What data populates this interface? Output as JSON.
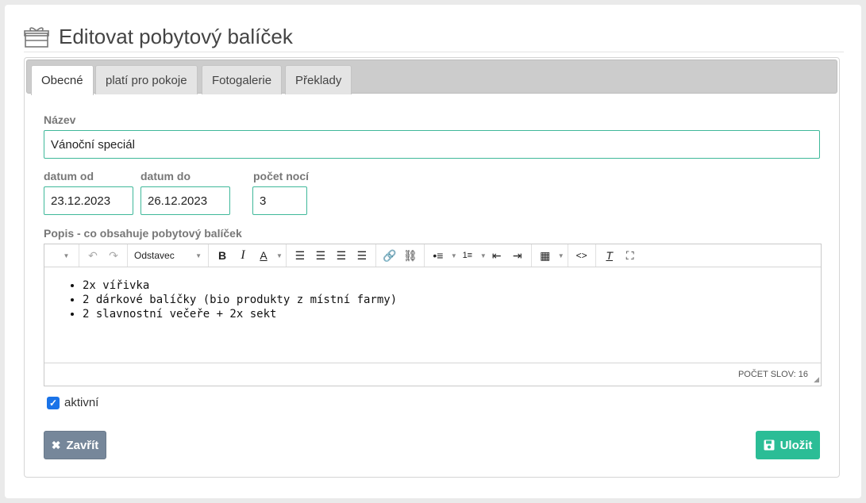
{
  "header": {
    "title": "Editovat pobytový balíček",
    "icon": "gift-icon"
  },
  "tabs": [
    {
      "label": "Obecné",
      "active": true
    },
    {
      "label": "platí pro pokoje",
      "active": false
    },
    {
      "label": "Fotogalerie",
      "active": false
    },
    {
      "label": "Překlady",
      "active": false
    }
  ],
  "form": {
    "name_label": "Název",
    "name_value": "Vánoční speciál",
    "date_from_label": "datum od",
    "date_from_value": "23.12.2023",
    "date_to_label": "datum do",
    "date_to_value": "26.12.2023",
    "nights_label": "počet nocí",
    "nights_value": "3",
    "description_label": "Popis - co obsahuje pobytový balíček"
  },
  "editor": {
    "format_select": "Odstavec",
    "items": [
      "2x vířivka",
      "2 dárkové balíčky (bio produkty z místní farmy)",
      "2 slavnostní večeře + 2x sekt"
    ],
    "word_count": "POČET SLOV: 16"
  },
  "active_checkbox": {
    "label": "aktivní",
    "checked": true
  },
  "buttons": {
    "close": "Zavřít",
    "save": "Uložit"
  },
  "colors": {
    "accent": "#2bbd96",
    "input_border": "#3fb89a",
    "close_button": "#76879a",
    "checkbox": "#1a73e8"
  }
}
